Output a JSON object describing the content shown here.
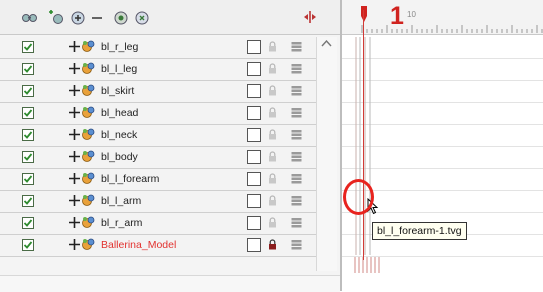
{
  "toolbar": {
    "icons": [
      "add-layers-icon",
      "add-drawing-layer-icon",
      "add-layer-icon",
      "delete-layer-icon",
      "add-peg-icon",
      "add-peg-layer-icon"
    ],
    "onion_skin_icon": "onion-skin-icon"
  },
  "layers": [
    {
      "name": "bl_r_leg",
      "enabled": true,
      "is_model": false
    },
    {
      "name": "bl_l_leg",
      "enabled": true,
      "is_model": false
    },
    {
      "name": "bl_skirt",
      "enabled": true,
      "is_model": false
    },
    {
      "name": "bl_head",
      "enabled": true,
      "is_model": false
    },
    {
      "name": "bl_neck",
      "enabled": true,
      "is_model": false
    },
    {
      "name": "bl_body",
      "enabled": true,
      "is_model": false
    },
    {
      "name": "bl_l_forearm",
      "enabled": true,
      "is_model": false
    },
    {
      "name": "bl_l_arm",
      "enabled": true,
      "is_model": false
    },
    {
      "name": "bl_r_arm",
      "enabled": true,
      "is_model": false
    },
    {
      "name": "Ballerina_Model",
      "enabled": true,
      "is_model": true
    }
  ],
  "timeline": {
    "current_frame": "1",
    "ruler_label": "10"
  },
  "tooltip": "bl_l_forearm-1.tvg",
  "colors": {
    "accent_red": "#d0231f",
    "model_name": "#e2322f",
    "checkbox_green": "#2e8b2e"
  }
}
